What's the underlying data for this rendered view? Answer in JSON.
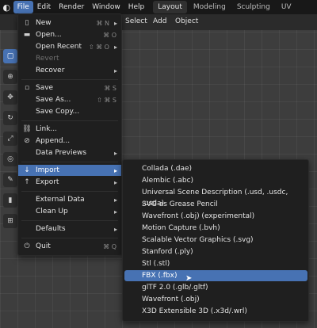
{
  "topbar": {
    "logo_icon": "blender-logo-icon",
    "menus": [
      "File",
      "Edit",
      "Render",
      "Window",
      "Help"
    ],
    "workspaces": [
      "Layout",
      "Modeling",
      "Sculpting",
      "UV Editing"
    ]
  },
  "header": {
    "select": "Select",
    "add": "Add",
    "object": "Object"
  },
  "file_menu": {
    "items": [
      {
        "label": "New",
        "shortcut": "⌘ N",
        "arrow": "▸",
        "icon": "new-file-icon"
      },
      {
        "label": "Open...",
        "shortcut": "⌘ O",
        "icon": "folder-icon"
      },
      {
        "label": "Open Recent",
        "shortcut": "⇧ ⌘ O",
        "arrow": "▸"
      },
      {
        "label": "Revert",
        "disabled": true
      },
      {
        "label": "Recover",
        "arrow": "▸"
      },
      {
        "label": "Save",
        "shortcut": "⌘ S",
        "icon": "save-icon"
      },
      {
        "label": "Save As...",
        "shortcut": "⇧ ⌘ S"
      },
      {
        "label": "Save Copy..."
      },
      {
        "label": "Link...",
        "icon": "link-icon"
      },
      {
        "label": "Append...",
        "icon": "append-icon"
      },
      {
        "label": "Data Previews",
        "arrow": "▸"
      },
      {
        "label": "Import",
        "arrow": "▸",
        "icon": "import-icon",
        "highlighted": true
      },
      {
        "label": "Export",
        "arrow": "▸",
        "icon": "export-icon"
      },
      {
        "label": "External Data",
        "arrow": "▸"
      },
      {
        "label": "Clean Up",
        "arrow": "▸"
      },
      {
        "label": "Defaults",
        "arrow": "▸"
      },
      {
        "label": "Quit",
        "shortcut": "⌘ Q",
        "icon": "quit-icon"
      }
    ]
  },
  "import_menu": {
    "items": [
      "Collada (.dae)",
      "Alembic (.abc)",
      "Universal Scene Description (.usd, .usdc, .usda)",
      "SVG as Grease Pencil",
      "Wavefront (.obj) (experimental)",
      "Motion Capture (.bvh)",
      "Scalable Vector Graphics (.svg)",
      "Stanford (.ply)",
      "Stl (.stl)",
      "FBX (.fbx)",
      "glTF 2.0 (.glb/.gltf)",
      "Wavefront (.obj)",
      "X3D Extensible 3D (.x3d/.wrl)"
    ],
    "highlighted_index": 9
  },
  "colors": {
    "accent": "#4772b3",
    "menu_bg": "#1f1f1f",
    "topbar_bg": "#181818"
  }
}
